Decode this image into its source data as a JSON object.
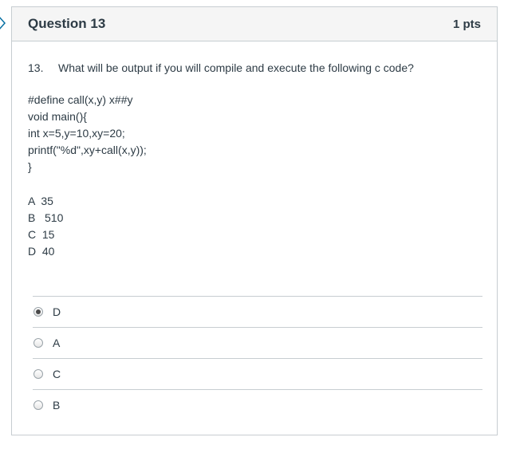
{
  "question": {
    "title": "Question 13",
    "points": "1 pts",
    "number": "13.",
    "text": "What will be output if you will compile and execute the following c code?",
    "code_lines": [
      "#define call(x,y) x##y",
      "void main(){",
      "int x=5,y=10,xy=20;",
      "printf(\"%d\",xy+call(x,y));",
      "}"
    ],
    "choice_lines": [
      "A  35",
      "B   510",
      "C  15",
      "D  40"
    ]
  },
  "answers": [
    {
      "label": "D",
      "selected": true
    },
    {
      "label": "A",
      "selected": false
    },
    {
      "label": "C",
      "selected": false
    },
    {
      "label": "B",
      "selected": false
    }
  ]
}
